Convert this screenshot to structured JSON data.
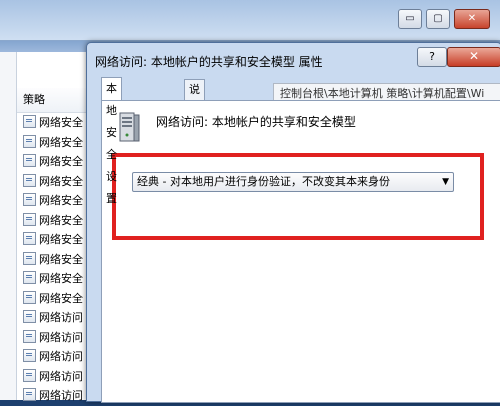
{
  "outer_window": {
    "controls": [
      "▭",
      "▢",
      "✕"
    ]
  },
  "policy_list": {
    "header": "策略",
    "rows": [
      "网络安全",
      "网络安全",
      "网络安全",
      "网络安全",
      "网络安全",
      "网络安全",
      "网络安全",
      "网络安全",
      "网络安全",
      "网络安全",
      "网络访问",
      "网络访问",
      "网络访问",
      "网络访问",
      "网络访问"
    ]
  },
  "dialog": {
    "title": "网络访问: 本地帐户的共享和安全模型 属性",
    "help_label": "?",
    "close_label": "✕",
    "tabs": [
      "本地安全设置",
      "说明"
    ],
    "tooltip": "控制台根\\本地计算机 策略\\计算机配置\\Wi",
    "policy_name": "网络访问: 本地帐户的共享和安全模型",
    "select_value": "经典 - 对本地用户进行身份验证，不改变其本来身份",
    "colors": {
      "highlight_border": "#e0211f"
    }
  }
}
